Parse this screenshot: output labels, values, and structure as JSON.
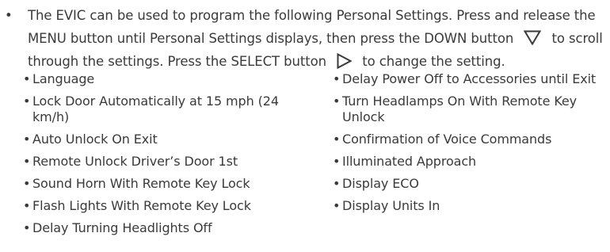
{
  "intro": {
    "bullet": "•",
    "text_1": "The EVIC can be used to program the following Personal Settings. Press and release the MENU button until Personal Settings displays, then press the DOWN button",
    "text_2": "to scroll through the settings. Press the SELECT button",
    "text_3": "to change the setting."
  },
  "icons": {
    "down": "down-triangle-icon",
    "select": "right-triangle-icon"
  },
  "bullet": "•",
  "settings_left": [
    "Language",
    "Lock Door Automatically at 15 mph (24 km/h)",
    "Auto Unlock On Exit",
    "Remote Unlock Driver’s Door 1st",
    "Sound Horn With Remote Key Lock",
    "Flash Lights With Remote Key Lock",
    "Delay Turning Headlights Off"
  ],
  "settings_right": [
    "Delay Power Off to Accessories until Exit",
    "Turn Headlamps On With Remote Key Unlock",
    "Confirmation of Voice Commands",
    "Illuminated Approach",
    "Display ECO",
    "Display Units In"
  ]
}
